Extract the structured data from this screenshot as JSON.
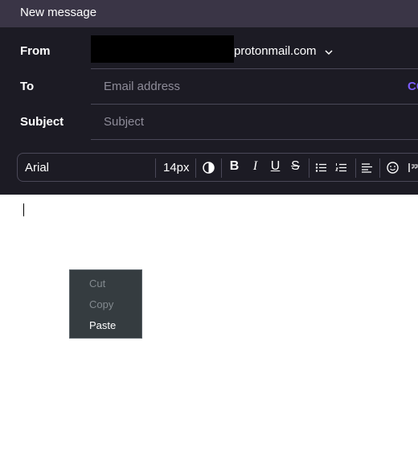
{
  "window": {
    "title": "New message"
  },
  "from": {
    "label": "From",
    "domain": "protonmail.com"
  },
  "to": {
    "label": "To",
    "placeholder": "Email address",
    "cc_label": "CC"
  },
  "subject": {
    "label": "Subject",
    "placeholder": "Subject"
  },
  "toolbar": {
    "font": "Arial",
    "size": "14px",
    "icons": [
      "contrast-icon",
      "bold-icon",
      "italic-icon",
      "underline-icon",
      "strikethrough-icon",
      "bullet-list-icon",
      "numbered-list-icon",
      "align-left-icon",
      "emoji-icon",
      "quote-icon"
    ]
  },
  "context_menu": {
    "items": [
      {
        "label": "Cut",
        "enabled": false
      },
      {
        "label": "Copy",
        "enabled": false
      },
      {
        "label": "Paste",
        "enabled": true
      }
    ]
  },
  "colors": {
    "accent": "#7c5cff",
    "header_bg": "#1c1b24",
    "titlebar_bg": "#3a3546"
  }
}
